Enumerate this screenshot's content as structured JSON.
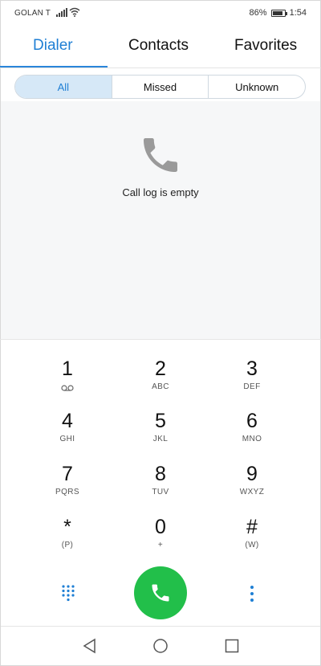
{
  "status_bar": {
    "carrier": "GOLAN T",
    "battery_percent": "86%",
    "battery_level": 0.86,
    "time": "1:54",
    "signal_icon": "signal-bars-icon",
    "wifi_icon": "wifi-icon",
    "battery_icon": "battery-icon"
  },
  "tabs": [
    {
      "label": "Dialer",
      "active": true
    },
    {
      "label": "Contacts",
      "active": false
    },
    {
      "label": "Favorites",
      "active": false
    }
  ],
  "filters": [
    {
      "label": "All",
      "active": true
    },
    {
      "label": "Missed",
      "active": false
    },
    {
      "label": "Unknown",
      "active": false
    }
  ],
  "call_log": {
    "empty_icon": "phone-handset-icon",
    "empty_text": "Call log is empty"
  },
  "keypad": [
    {
      "digit": "1",
      "letters": "",
      "icon": "voicemail-icon"
    },
    {
      "digit": "2",
      "letters": "ABC"
    },
    {
      "digit": "3",
      "letters": "DEF"
    },
    {
      "digit": "4",
      "letters": "GHI"
    },
    {
      "digit": "5",
      "letters": "JKL"
    },
    {
      "digit": "6",
      "letters": "MNO"
    },
    {
      "digit": "7",
      "letters": "PQRS"
    },
    {
      "digit": "8",
      "letters": "TUV"
    },
    {
      "digit": "9",
      "letters": "WXYZ"
    },
    {
      "digit": "*",
      "letters": "(P)"
    },
    {
      "digit": "0",
      "letters": "+"
    },
    {
      "digit": "#",
      "letters": "(W)"
    }
  ],
  "actions": {
    "dialpad_icon": "dialpad-grid-icon",
    "call_icon": "phone-call-icon",
    "more_icon": "more-vertical-icon"
  },
  "colors": {
    "accent": "#1f7fd4",
    "call_green": "#22bf4a",
    "active_filter_bg": "#d6e8f7"
  },
  "nav": {
    "back_icon": "back-triangle-icon",
    "home_icon": "home-circle-icon",
    "recents_icon": "recents-square-icon"
  }
}
